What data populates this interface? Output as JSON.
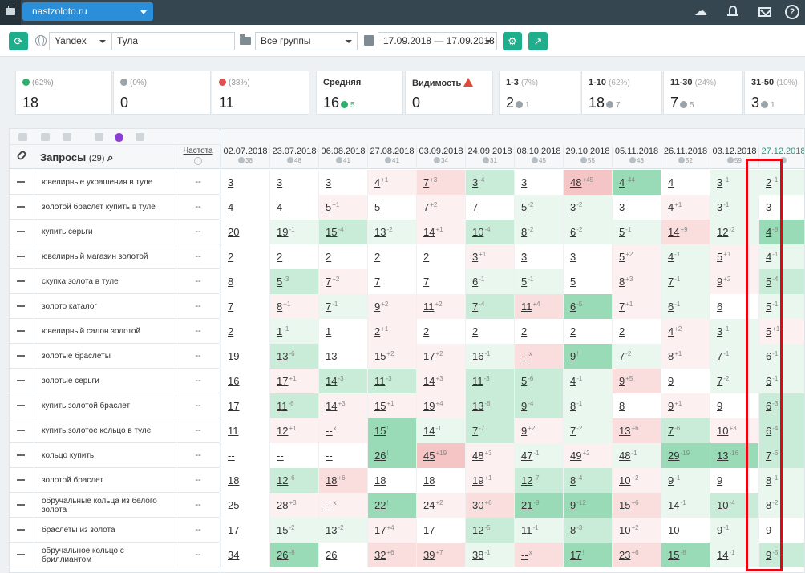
{
  "topbar": {
    "site": "nastzoloto.ru",
    "icons": [
      "weather-icon",
      "bell-icon",
      "mail-icon",
      "help-icon"
    ],
    "help_glyph": "?"
  },
  "toolbar": {
    "engine": "Yandex",
    "region": "Тула",
    "group": "Все группы",
    "date_range": "17.09.2018 — 17.09.2018"
  },
  "stats": [
    {
      "key": "up",
      "pct": "(62%)",
      "value": "18"
    },
    {
      "key": "same",
      "pct": "(0%)",
      "value": "0"
    },
    {
      "key": "down",
      "pct": "(38%)",
      "value": "11"
    }
  ],
  "avg": {
    "label": "Средняя",
    "value": "16",
    "delta": "5"
  },
  "visibility": {
    "label": "Видимость",
    "value": "0"
  },
  "tops": [
    {
      "label": "1-3",
      "pct": "(7%)",
      "value": "2",
      "delta": "1"
    },
    {
      "label": "1-10",
      "pct": "(62%)",
      "value": "18",
      "delta": "7"
    },
    {
      "label": "11-30",
      "pct": "(24%)",
      "value": "7",
      "delta": "5"
    },
    {
      "label": "31-50",
      "pct": "(10%)",
      "value": "3",
      "delta": "1"
    }
  ],
  "table": {
    "title": "Запросы",
    "count": "(29)",
    "freq_label": "Частота",
    "dates": [
      {
        "d": "02.07.2018",
        "c": "38"
      },
      {
        "d": "23.07.2018",
        "c": "48"
      },
      {
        "d": "06.08.2018",
        "c": "41"
      },
      {
        "d": "27.08.2018",
        "c": "41"
      },
      {
        "d": "03.09.2018",
        "c": "34"
      },
      {
        "d": "24.09.2018",
        "c": "31"
      },
      {
        "d": "08.10.2018",
        "c": "45"
      },
      {
        "d": "29.10.2018",
        "c": "55"
      },
      {
        "d": "05.11.2018",
        "c": "48"
      },
      {
        "d": "26.11.2018",
        "c": "52"
      },
      {
        "d": "03.12.2018",
        "c": "59"
      },
      {
        "d": "27.12.2018",
        "c": ""
      }
    ],
    "rows": [
      {
        "q": "ювелирные украшения в туле",
        "f": "--",
        "cells": [
          [
            "3",
            "",
            "n"
          ],
          [
            "3",
            "",
            "n"
          ],
          [
            "3",
            "",
            "n"
          ],
          [
            "4",
            "+1",
            "lr"
          ],
          [
            "7",
            "+3",
            "mr"
          ],
          [
            "3",
            "-4",
            "mg"
          ],
          [
            "3",
            "",
            "n"
          ],
          [
            "48",
            "+45",
            "dr"
          ],
          [
            "4",
            "-44",
            "dg"
          ],
          [
            "4",
            "",
            "n"
          ],
          [
            "3",
            "-1",
            "lg"
          ],
          [
            "2",
            "-1",
            "lg"
          ]
        ]
      },
      {
        "q": "золотой браслет купить в туле",
        "f": "--",
        "cells": [
          [
            "4",
            "",
            "n"
          ],
          [
            "4",
            "",
            "n"
          ],
          [
            "5",
            "+1",
            "lr"
          ],
          [
            "5",
            "",
            "n"
          ],
          [
            "7",
            "+2",
            "lr"
          ],
          [
            "7",
            "",
            "n"
          ],
          [
            "5",
            "-2",
            "lg"
          ],
          [
            "3",
            "-2",
            "lg"
          ],
          [
            "3",
            "",
            "n"
          ],
          [
            "4",
            "+1",
            "lr"
          ],
          [
            "3",
            "-1",
            "lg"
          ],
          [
            "3",
            "",
            "n"
          ]
        ]
      },
      {
        "q": "купить серьги",
        "f": "--",
        "cells": [
          [
            "20",
            "",
            "n"
          ],
          [
            "19",
            "-1",
            "lg"
          ],
          [
            "15",
            "-4",
            "mg"
          ],
          [
            "13",
            "-2",
            "lg"
          ],
          [
            "14",
            "+1",
            "lr"
          ],
          [
            "10",
            "-4",
            "mg"
          ],
          [
            "8",
            "-2",
            "lg"
          ],
          [
            "6",
            "-2",
            "lg"
          ],
          [
            "5",
            "-1",
            "lg"
          ],
          [
            "14",
            "+9",
            "mr"
          ],
          [
            "12",
            "-2",
            "lg"
          ],
          [
            "4",
            "-8",
            "dg"
          ]
        ]
      },
      {
        "q": "ювелирный магазин золотой",
        "f": "--",
        "cells": [
          [
            "2",
            "",
            "n"
          ],
          [
            "2",
            "",
            "n"
          ],
          [
            "2",
            "",
            "n"
          ],
          [
            "2",
            "",
            "n"
          ],
          [
            "2",
            "",
            "n"
          ],
          [
            "3",
            "+1",
            "lr"
          ],
          [
            "3",
            "",
            "n"
          ],
          [
            "3",
            "",
            "n"
          ],
          [
            "5",
            "+2",
            "lr"
          ],
          [
            "4",
            "-1",
            "lg"
          ],
          [
            "5",
            "+1",
            "lr"
          ],
          [
            "4",
            "-1",
            "lg"
          ]
        ]
      },
      {
        "q": "скупка золота в туле",
        "f": "--",
        "cells": [
          [
            "8",
            "",
            "n"
          ],
          [
            "5",
            "-3",
            "mg"
          ],
          [
            "7",
            "+2",
            "lr"
          ],
          [
            "7",
            "",
            "n"
          ],
          [
            "7",
            "",
            "n"
          ],
          [
            "6",
            "-1",
            "lg"
          ],
          [
            "5",
            "-1",
            "lg"
          ],
          [
            "5",
            "",
            "n"
          ],
          [
            "8",
            "+3",
            "lr"
          ],
          [
            "7",
            "-1",
            "lg"
          ],
          [
            "9",
            "+2",
            "lr"
          ],
          [
            "5",
            "-4",
            "mg"
          ]
        ]
      },
      {
        "q": "золото каталог",
        "f": "--",
        "cells": [
          [
            "7",
            "",
            "n"
          ],
          [
            "8",
            "+1",
            "lr"
          ],
          [
            "7",
            "-1",
            "lg"
          ],
          [
            "9",
            "+2",
            "lr"
          ],
          [
            "11",
            "+2",
            "lr"
          ],
          [
            "7",
            "-4",
            "mg"
          ],
          [
            "11",
            "+4",
            "mr"
          ],
          [
            "6",
            "-5",
            "dg"
          ],
          [
            "7",
            "+1",
            "lr"
          ],
          [
            "6",
            "-1",
            "lg"
          ],
          [
            "6",
            "",
            "n"
          ],
          [
            "5",
            "-1",
            "lg"
          ]
        ]
      },
      {
        "q": "ювелирный салон золотой",
        "f": "--",
        "cells": [
          [
            "2",
            "",
            "n"
          ],
          [
            "1",
            "-1",
            "lg"
          ],
          [
            "1",
            "",
            "n"
          ],
          [
            "2",
            "+1",
            "lr"
          ],
          [
            "2",
            "",
            "n"
          ],
          [
            "2",
            "",
            "n"
          ],
          [
            "2",
            "",
            "n"
          ],
          [
            "2",
            "",
            "n"
          ],
          [
            "2",
            "",
            "n"
          ],
          [
            "4",
            "+2",
            "lr"
          ],
          [
            "3",
            "-1",
            "lg"
          ],
          [
            "5",
            "+1",
            "lr"
          ]
        ]
      },
      {
        "q": "золотые браслеты",
        "f": "--",
        "cells": [
          [
            "19",
            "",
            "n"
          ],
          [
            "13",
            "-6",
            "mg"
          ],
          [
            "13",
            "",
            "n"
          ],
          [
            "15",
            "+2",
            "lr"
          ],
          [
            "17",
            "+2",
            "lr"
          ],
          [
            "16",
            "-1",
            "lg"
          ],
          [
            "--",
            "x",
            "mr"
          ],
          [
            "9",
            "!",
            "dg"
          ],
          [
            "7",
            "-2",
            "lg"
          ],
          [
            "8",
            "+1",
            "lr"
          ],
          [
            "7",
            "-1",
            "lg"
          ],
          [
            "6",
            "-1",
            "lg"
          ]
        ]
      },
      {
        "q": "золотые серьги",
        "f": "--",
        "cells": [
          [
            "16",
            "",
            "n"
          ],
          [
            "17",
            "+1",
            "lr"
          ],
          [
            "14",
            "-3",
            "mg"
          ],
          [
            "11",
            "-3",
            "mg"
          ],
          [
            "14",
            "+3",
            "lr"
          ],
          [
            "11",
            "-3",
            "mg"
          ],
          [
            "5",
            "-6",
            "mg"
          ],
          [
            "4",
            "-1",
            "lg"
          ],
          [
            "9",
            "+5",
            "mr"
          ],
          [
            "9",
            "",
            "n"
          ],
          [
            "7",
            "-2",
            "lg"
          ],
          [
            "6",
            "-1",
            "lg"
          ]
        ]
      },
      {
        "q": "купить золотой браслет",
        "f": "--",
        "cells": [
          [
            "17",
            "",
            "n"
          ],
          [
            "11",
            "-6",
            "mg"
          ],
          [
            "14",
            "+3",
            "lr"
          ],
          [
            "15",
            "+1",
            "lr"
          ],
          [
            "19",
            "+4",
            "lr"
          ],
          [
            "13",
            "-6",
            "mg"
          ],
          [
            "9",
            "-4",
            "mg"
          ],
          [
            "8",
            "-1",
            "lg"
          ],
          [
            "8",
            "",
            "n"
          ],
          [
            "9",
            "+1",
            "lr"
          ],
          [
            "9",
            "",
            "n"
          ],
          [
            "6",
            "-3",
            "mg"
          ]
        ]
      },
      {
        "q": "купить золотое кольцо в туле",
        "f": "--",
        "cells": [
          [
            "11",
            "",
            "n"
          ],
          [
            "12",
            "+1",
            "lr"
          ],
          [
            "--",
            "x",
            "lr"
          ],
          [
            "15",
            "!",
            "dg"
          ],
          [
            "14",
            "-1",
            "lg"
          ],
          [
            "7",
            "-7",
            "mg"
          ],
          [
            "9",
            "+2",
            "lr"
          ],
          [
            "7",
            "-2",
            "lg"
          ],
          [
            "13",
            "+6",
            "mr"
          ],
          [
            "7",
            "-6",
            "mg"
          ],
          [
            "10",
            "+3",
            "lr"
          ],
          [
            "6",
            "-4",
            "mg"
          ]
        ]
      },
      {
        "q": "кольцо купить",
        "f": "--",
        "cells": [
          [
            "--",
            "",
            "n"
          ],
          [
            "--",
            "",
            "n"
          ],
          [
            "--",
            "",
            "n"
          ],
          [
            "26",
            "!",
            "dg"
          ],
          [
            "45",
            "+19",
            "dr"
          ],
          [
            "48",
            "+3",
            "lr"
          ],
          [
            "47",
            "-1",
            "lg"
          ],
          [
            "49",
            "+2",
            "lr"
          ],
          [
            "48",
            "-1",
            "lg"
          ],
          [
            "29",
            "-19",
            "dg"
          ],
          [
            "13",
            "-16",
            "dg"
          ],
          [
            "7",
            "-6",
            "mg"
          ]
        ]
      },
      {
        "q": "золотой браслет",
        "f": "--",
        "cells": [
          [
            "18",
            "",
            "n"
          ],
          [
            "12",
            "-6",
            "mg"
          ],
          [
            "18",
            "+6",
            "mr"
          ],
          [
            "18",
            "",
            "n"
          ],
          [
            "18",
            "",
            "n"
          ],
          [
            "19",
            "+1",
            "lr"
          ],
          [
            "12",
            "-7",
            "mg"
          ],
          [
            "8",
            "-4",
            "mg"
          ],
          [
            "10",
            "+2",
            "lr"
          ],
          [
            "9",
            "-1",
            "lg"
          ],
          [
            "9",
            "",
            "n"
          ],
          [
            "8",
            "-1",
            "lg"
          ]
        ]
      },
      {
        "q": "обручальные кольца из белого золота",
        "f": "--",
        "cells": [
          [
            "25",
            "",
            "n"
          ],
          [
            "28",
            "+3",
            "lr"
          ],
          [
            "--",
            "x",
            "lr"
          ],
          [
            "22",
            "!",
            "dg"
          ],
          [
            "24",
            "+2",
            "lr"
          ],
          [
            "30",
            "+6",
            "mr"
          ],
          [
            "21",
            "-9",
            "dg"
          ],
          [
            "9",
            "-12",
            "dg"
          ],
          [
            "15",
            "+6",
            "mr"
          ],
          [
            "14",
            "-1",
            "lg"
          ],
          [
            "10",
            "-4",
            "mg"
          ],
          [
            "8",
            "-2",
            "lg"
          ]
        ]
      },
      {
        "q": "браслеты из золота",
        "f": "--",
        "cells": [
          [
            "17",
            "",
            "n"
          ],
          [
            "15",
            "-2",
            "lg"
          ],
          [
            "13",
            "-2",
            "lg"
          ],
          [
            "17",
            "+4",
            "lr"
          ],
          [
            "17",
            "",
            "n"
          ],
          [
            "12",
            "-5",
            "mg"
          ],
          [
            "11",
            "-1",
            "lg"
          ],
          [
            "8",
            "-3",
            "mg"
          ],
          [
            "10",
            "+2",
            "lr"
          ],
          [
            "10",
            "",
            "n"
          ],
          [
            "9",
            "-1",
            "lg"
          ],
          [
            "9",
            "",
            "n"
          ]
        ]
      },
      {
        "q": "обручальное кольцо с бриллиантом",
        "f": "--",
        "cells": [
          [
            "34",
            "",
            "n"
          ],
          [
            "26",
            "-8",
            "dg"
          ],
          [
            "26",
            "",
            "n"
          ],
          [
            "32",
            "+6",
            "mr"
          ],
          [
            "39",
            "+7",
            "mr"
          ],
          [
            "38",
            "-1",
            "lg"
          ],
          [
            "--",
            "x",
            "mr"
          ],
          [
            "17",
            "!",
            "dg"
          ],
          [
            "23",
            "+6",
            "mr"
          ],
          [
            "15",
            "-8",
            "dg"
          ],
          [
            "14",
            "-1",
            "lg"
          ],
          [
            "9",
            "-5",
            "mg"
          ]
        ]
      }
    ]
  }
}
